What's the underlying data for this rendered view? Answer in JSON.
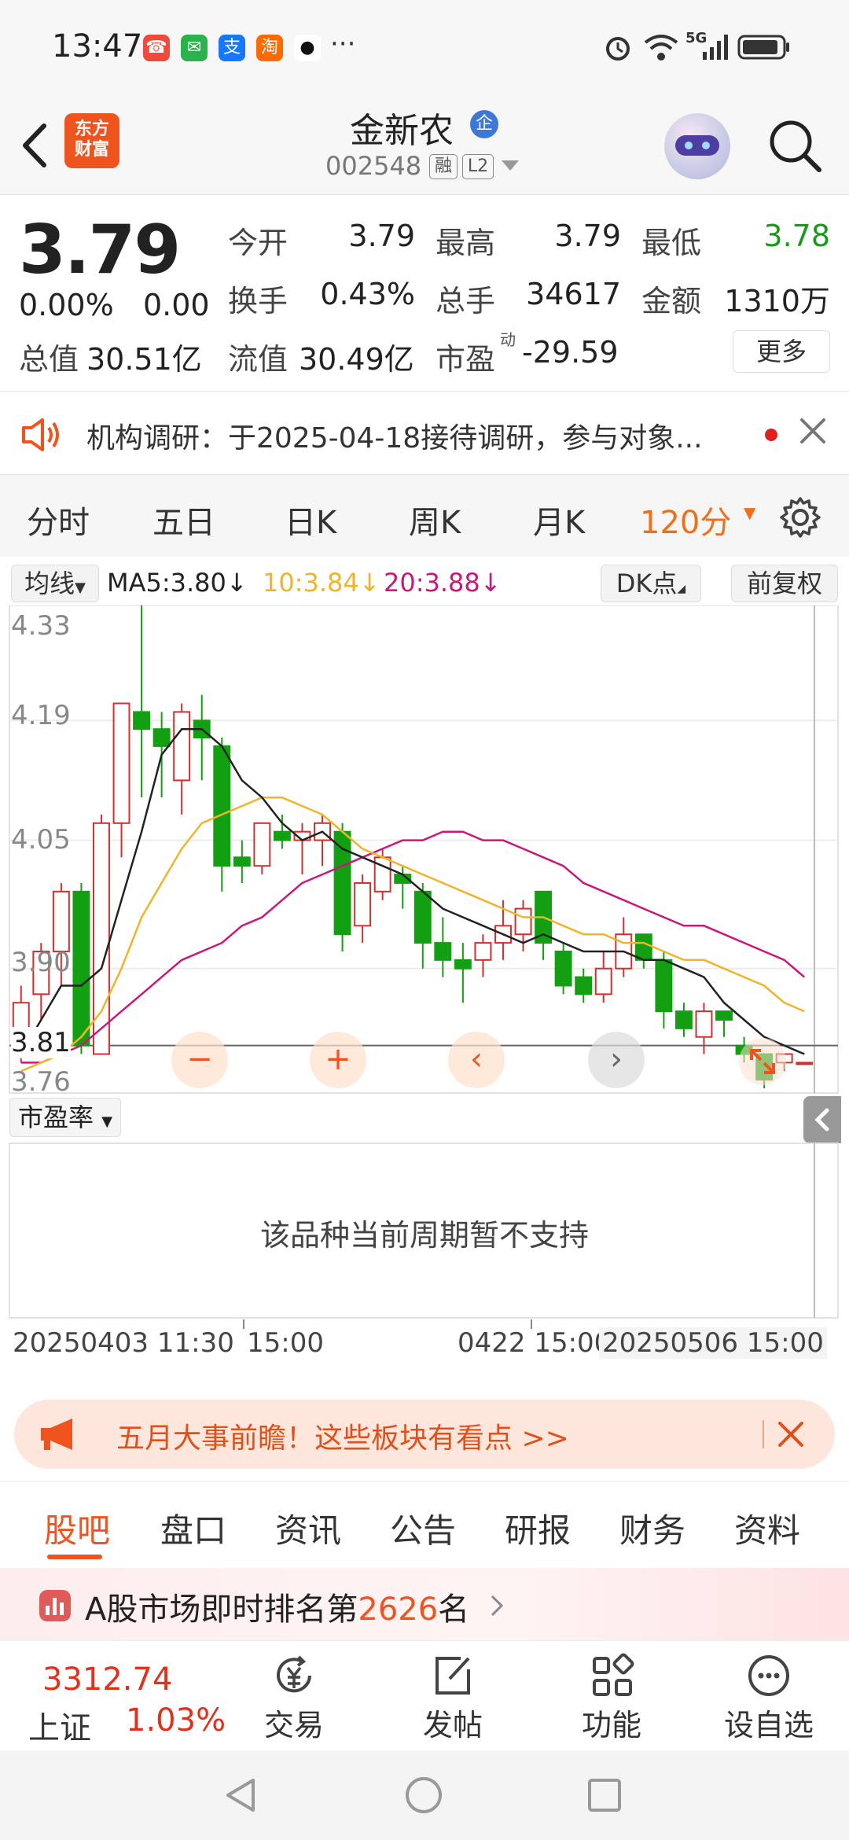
{
  "status_bar": {
    "time": "13:47",
    "app_icons": [
      "missed-call-icon",
      "wechat-icon",
      "alipay-icon",
      "taobao-icon",
      "qq-icon"
    ],
    "more": "···",
    "system_icons": [
      "alarm-icon",
      "wifi-icon",
      "5g-signal-icon",
      "battery-icon"
    ],
    "network": "5G"
  },
  "header": {
    "logo_line1": "东方",
    "logo_line2": "财富",
    "stock_name": "金新农",
    "badge": "企",
    "stock_code": "002548",
    "tag_margin": "融",
    "tag_level": "L2"
  },
  "quote": {
    "price": "3.79",
    "change_pct": "0.00%",
    "change_amt": "0.00",
    "open_label": "今开",
    "open": "3.79",
    "high_label": "最高",
    "high": "3.79",
    "low_label": "最低",
    "low": "3.78",
    "turnover_label": "换手",
    "turnover": "0.43%",
    "volume_label": "总手",
    "volume": "34617",
    "amount_label": "金额",
    "amount": "1310万",
    "total_value_label": "总值",
    "total_value": "30.51亿",
    "float_value_label": "流值",
    "float_value": "30.49亿",
    "pe_label": "市盈",
    "pe_sup": "动",
    "pe": "-29.59",
    "more": "更多",
    "colors": {
      "down": "#1a9a1a",
      "up": "#e0301e"
    }
  },
  "news": {
    "text": "机构调研：于2025-04-18接待调研，参与对象..."
  },
  "period_tabs": {
    "items": [
      "分时",
      "五日",
      "日K",
      "周K",
      "月K"
    ],
    "active": "120分",
    "accent": "#f0701a"
  },
  "indicator": {
    "selector": "均线",
    "ma5": "MA5:3.80",
    "ma10": "10:3.84",
    "ma20": "20:3.88",
    "arrow": "↓",
    "dk": "DK点",
    "adjust": "前复权",
    "ma_colors": {
      "ma5": "#222222",
      "ma10": "#f0b429",
      "ma20": "#c8187a"
    }
  },
  "chart_data": {
    "type": "candlestick",
    "price_labels": [
      "4.33",
      "4.19",
      "4.05",
      "3.90",
      "3.76"
    ],
    "current_price": "3.81",
    "ylim": [
      3.76,
      4.33
    ],
    "candles": [
      {
        "o": 3.81,
        "c": 3.86,
        "h": 3.88,
        "l": 3.79
      },
      {
        "o": 3.87,
        "c": 3.92,
        "h": 3.93,
        "l": 3.84
      },
      {
        "o": 3.92,
        "c": 3.99,
        "h": 4.0,
        "l": 3.88
      },
      {
        "o": 3.99,
        "c": 3.81,
        "h": 4.0,
        "l": 3.8
      },
      {
        "o": 3.8,
        "c": 4.07,
        "h": 4.08,
        "l": 3.8
      },
      {
        "o": 4.07,
        "c": 4.21,
        "h": 4.21,
        "l": 4.03
      },
      {
        "o": 4.2,
        "c": 4.18,
        "h": 4.33,
        "l": 4.1
      },
      {
        "o": 4.18,
        "c": 4.16,
        "h": 4.2,
        "l": 4.1
      },
      {
        "o": 4.12,
        "c": 4.2,
        "h": 4.21,
        "l": 4.08
      },
      {
        "o": 4.19,
        "c": 4.17,
        "h": 4.22,
        "l": 4.12
      },
      {
        "o": 4.16,
        "c": 4.02,
        "h": 4.17,
        "l": 3.99
      },
      {
        "o": 4.03,
        "c": 4.02,
        "h": 4.05,
        "l": 4.0
      },
      {
        "o": 4.02,
        "c": 4.07,
        "h": 4.07,
        "l": 4.01
      },
      {
        "o": 4.06,
        "c": 4.05,
        "h": 4.08,
        "l": 4.04
      },
      {
        "o": 4.05,
        "c": 4.06,
        "h": 4.07,
        "l": 4.01
      },
      {
        "o": 4.05,
        "c": 4.07,
        "h": 4.08,
        "l": 4.02
      },
      {
        "o": 4.06,
        "c": 3.94,
        "h": 4.07,
        "l": 3.92
      },
      {
        "o": 3.95,
        "c": 4.0,
        "h": 4.01,
        "l": 3.93
      },
      {
        "o": 3.99,
        "c": 4.03,
        "h": 4.04,
        "l": 3.98
      },
      {
        "o": 4.01,
        "c": 4.0,
        "h": 4.02,
        "l": 3.97
      },
      {
        "o": 3.99,
        "c": 3.93,
        "h": 4.0,
        "l": 3.9
      },
      {
        "o": 3.93,
        "c": 3.91,
        "h": 3.96,
        "l": 3.89
      },
      {
        "o": 3.91,
        "c": 3.9,
        "h": 3.93,
        "l": 3.86
      },
      {
        "o": 3.91,
        "c": 3.93,
        "h": 3.94,
        "l": 3.89
      },
      {
        "o": 3.93,
        "c": 3.95,
        "h": 3.98,
        "l": 3.91
      },
      {
        "o": 3.94,
        "c": 3.97,
        "h": 3.98,
        "l": 3.92
      },
      {
        "o": 3.99,
        "c": 3.93,
        "h": 3.99,
        "l": 3.91
      },
      {
        "o": 3.92,
        "c": 3.88,
        "h": 3.93,
        "l": 3.87
      },
      {
        "o": 3.89,
        "c": 3.87,
        "h": 3.9,
        "l": 3.86
      },
      {
        "o": 3.87,
        "c": 3.9,
        "h": 3.92,
        "l": 3.86
      },
      {
        "o": 3.9,
        "c": 3.94,
        "h": 3.96,
        "l": 3.89
      },
      {
        "o": 3.94,
        "c": 3.91,
        "h": 3.94,
        "l": 3.9
      },
      {
        "o": 3.91,
        "c": 3.85,
        "h": 3.92,
        "l": 3.83
      },
      {
        "o": 3.85,
        "c": 3.83,
        "h": 3.86,
        "l": 3.82
      },
      {
        "o": 3.82,
        "c": 3.85,
        "h": 3.86,
        "l": 3.8
      },
      {
        "o": 3.85,
        "c": 3.84,
        "h": 3.85,
        "l": 3.82
      },
      {
        "o": 3.81,
        "c": 3.8,
        "h": 3.82,
        "l": 3.79
      },
      {
        "o": 3.8,
        "c": 3.77,
        "h": 3.8,
        "l": 3.76
      },
      {
        "o": 3.79,
        "c": 3.8,
        "h": 3.8,
        "l": 3.78
      },
      {
        "o": 3.79,
        "c": 3.79,
        "h": 3.79,
        "l": 3.79
      }
    ],
    "ma5": [
      3.8,
      3.84,
      3.88,
      3.88,
      3.9,
      3.98,
      4.06,
      4.15,
      4.18,
      4.18,
      4.16,
      4.12,
      4.1,
      4.07,
      4.05,
      4.06,
      4.04,
      4.03,
      4.02,
      4.01,
      3.99,
      3.97,
      3.96,
      3.95,
      3.94,
      3.93,
      3.94,
      3.93,
      3.92,
      3.92,
      3.92,
      3.91,
      3.91,
      3.9,
      3.89,
      3.86,
      3.84,
      3.82,
      3.81,
      3.8
    ],
    "ma10": [
      3.78,
      3.79,
      3.8,
      3.82,
      3.85,
      3.9,
      3.96,
      4.0,
      4.04,
      4.07,
      4.08,
      4.09,
      4.1,
      4.1,
      4.09,
      4.08,
      4.06,
      4.04,
      4.03,
      4.02,
      4.01,
      4.0,
      3.99,
      3.98,
      3.97,
      3.96,
      3.96,
      3.95,
      3.94,
      3.94,
      3.93,
      3.93,
      3.92,
      3.91,
      3.91,
      3.9,
      3.89,
      3.88,
      3.86,
      3.85
    ],
    "ma20": [
      3.79,
      3.79,
      3.8,
      3.81,
      3.83,
      3.85,
      3.87,
      3.89,
      3.91,
      3.92,
      3.93,
      3.95,
      3.96,
      3.98,
      4.0,
      4.01,
      4.02,
      4.03,
      4.04,
      4.05,
      4.05,
      4.06,
      4.06,
      4.05,
      4.05,
      4.04,
      4.03,
      4.02,
      4.0,
      3.99,
      3.98,
      3.97,
      3.96,
      3.95,
      3.95,
      3.94,
      3.93,
      3.92,
      3.91,
      3.89
    ]
  },
  "chart_controls": [
    "−",
    "+",
    "‹",
    "›"
  ],
  "sub_indicator": {
    "selector": "市盈率",
    "message": "该品种当前周期暂不支持"
  },
  "dates": {
    "start": "20250403 11:30",
    "mid1": "15:00",
    "mid2": "0422 15:00",
    "end": "20250506 15:00"
  },
  "promo": {
    "text": "五月大事前瞻！这些板块有看点 >>"
  },
  "bottom_tabs": {
    "items": [
      "股吧",
      "盘口",
      "资讯",
      "公告",
      "研报",
      "财务",
      "资料"
    ],
    "active_index": 0
  },
  "rank": {
    "prefix": "A股市场即时排名第",
    "number": "2626",
    "suffix": "名"
  },
  "toolbar": {
    "index_value": "3312.74",
    "index_name": "上证",
    "index_pct": "1.03%",
    "items": [
      "交易",
      "发帖",
      "功能",
      "设自选"
    ]
  }
}
